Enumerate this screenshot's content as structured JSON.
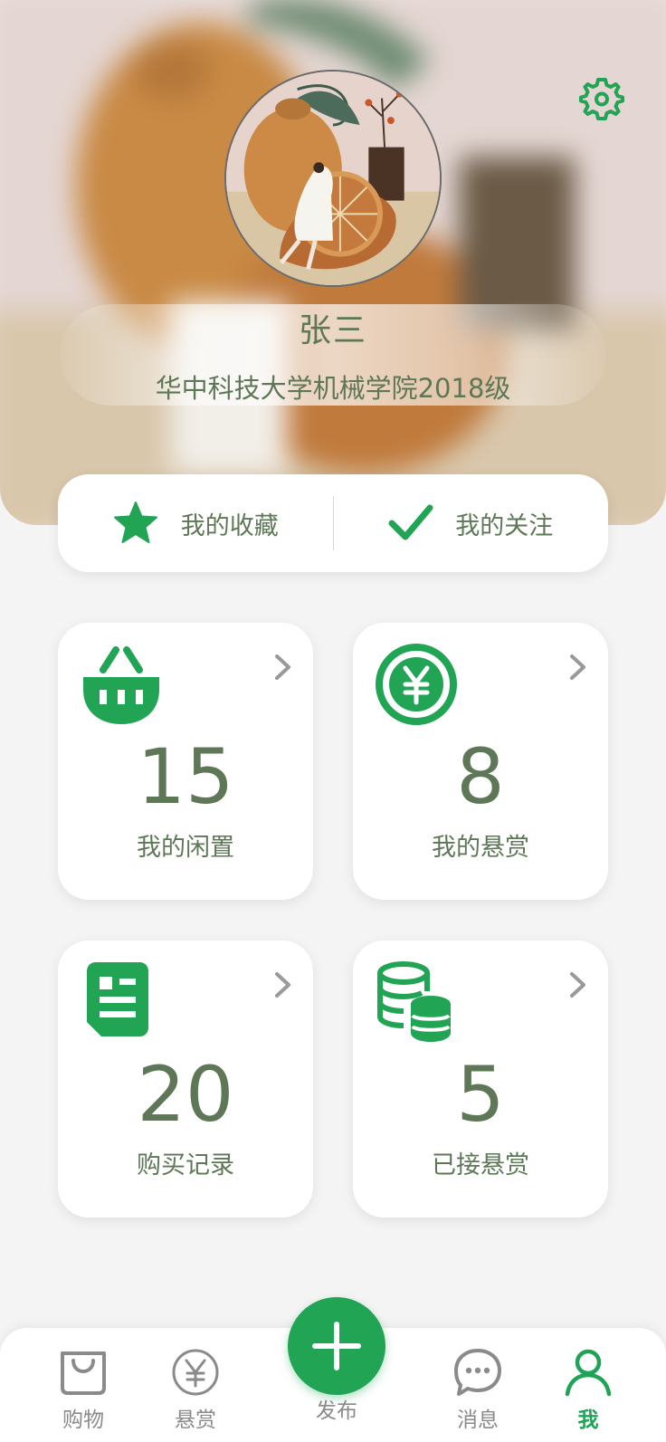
{
  "profile": {
    "name": "张三",
    "school": "华中科技大学机械学院2018级"
  },
  "quick_links": {
    "favorites": {
      "label": "我的收藏",
      "icon": "star-icon"
    },
    "follows": {
      "label": "我的关注",
      "icon": "checkmark-icon"
    }
  },
  "stats": [
    {
      "count": "15",
      "label": "我的闲置",
      "icon": "basket-icon"
    },
    {
      "count": "8",
      "label": "我的悬赏",
      "icon": "yuan-coin-icon"
    },
    {
      "count": "20",
      "label": "购买记录",
      "icon": "receipt-icon"
    },
    {
      "count": "5",
      "label": "已接悬赏",
      "icon": "coin-stack-icon"
    }
  ],
  "tabbar": {
    "items": [
      {
        "label": "购物",
        "icon": "shopping-bag-icon"
      },
      {
        "label": "悬赏",
        "icon": "yuan-circle-icon"
      },
      {
        "label": "发布",
        "icon": "plus-icon"
      },
      {
        "label": "消息",
        "icon": "chat-bubble-icon"
      },
      {
        "label": "我",
        "icon": "person-icon"
      }
    ],
    "active": "我"
  },
  "colors": {
    "accent": "#22a455",
    "text": "#5e7757",
    "inactive": "#8a8a8a",
    "background": "#f4f4f4"
  }
}
